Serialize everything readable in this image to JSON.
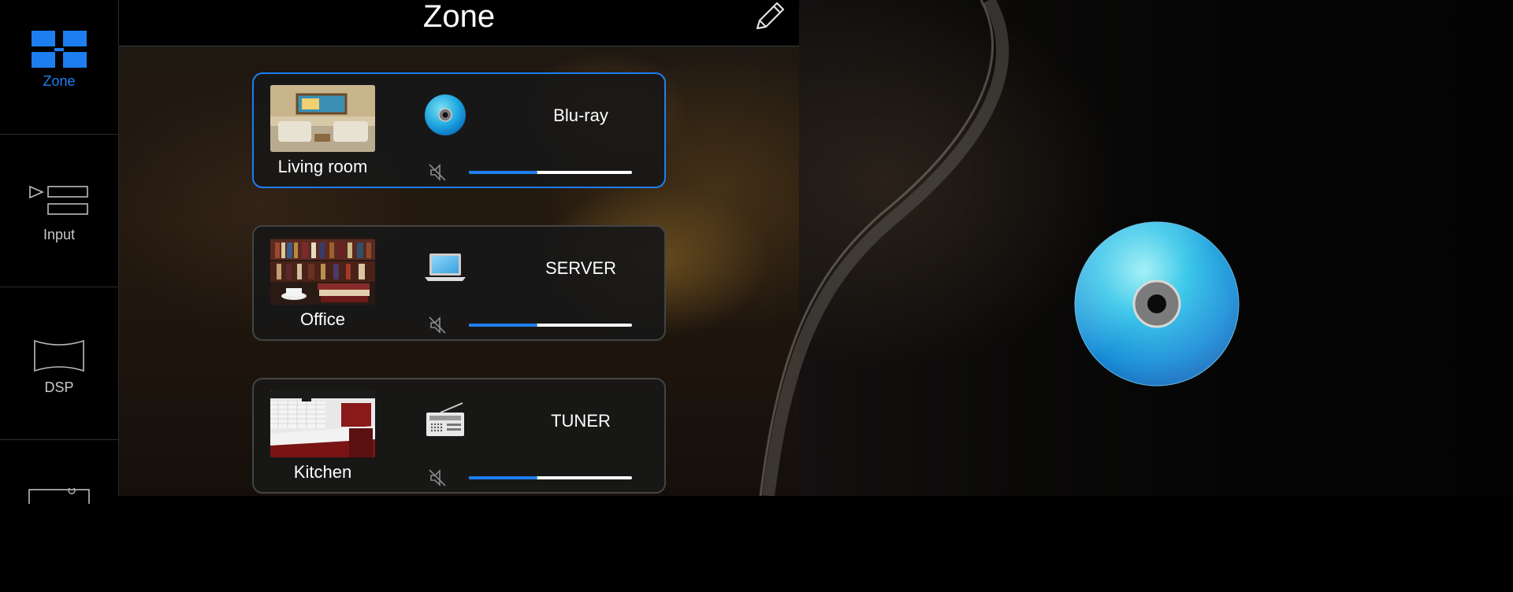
{
  "header": {
    "title": "Zone"
  },
  "nav": {
    "items": [
      {
        "label": "Zone",
        "active": true
      },
      {
        "label": "Input",
        "active": false
      },
      {
        "label": "DSP",
        "active": false
      },
      {
        "label": "",
        "active": false
      }
    ]
  },
  "zones": [
    {
      "name": "Living room",
      "source": "Blu-ray",
      "source_icon": "bluray-disc-icon",
      "muted": true,
      "volume_fraction": 0.42,
      "selected": true
    },
    {
      "name": "Office",
      "source": "SERVER",
      "source_icon": "laptop-icon",
      "muted": true,
      "volume_fraction": 0.42,
      "selected": false
    },
    {
      "name": "Kitchen",
      "source": "TUNER",
      "source_icon": "radio-icon",
      "muted": true,
      "volume_fraction": 0.42,
      "selected": false
    }
  ],
  "now_playing": {
    "icon": "bluray-disc-icon"
  },
  "colors": {
    "accent": "#1e7ef0",
    "card_bg": "#181818",
    "card_border": "#444444"
  }
}
